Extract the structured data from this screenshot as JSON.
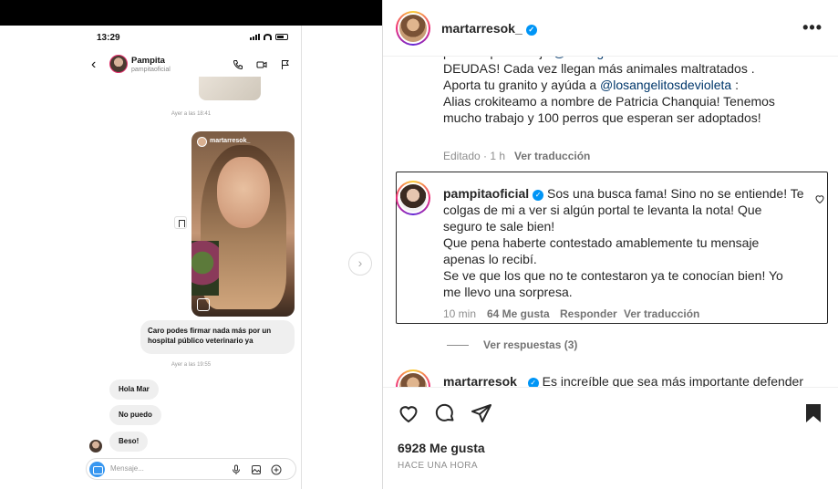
{
  "phone": {
    "time": "13:29",
    "chat_name": "Pampita",
    "chat_user": "pampitaoficial",
    "ts1": "Ayer a las 18:41",
    "story_user": "martarresok_",
    "bubble1": "Caro podes firmar nada más por un hospital público veterinario ya",
    "ts2": "Ayer a las 19:55",
    "msg1": "Hola Mar",
    "msg2": "No puedo",
    "msg3": "Beso!",
    "composer_placeholder": "Mensaje..."
  },
  "post": {
    "author": "martarresok_",
    "caption_l1_pre": "para el que trabajo ",
    "caption_l1_link": "@losangelitosdevioleta",
    "caption_l1_post": " NO DA MÁS DE",
    "caption_l2": "DEUDAS! Cada vez llegan más animales maltratados .",
    "caption_l3_pre": "Aporta tu granito y ayúda a ",
    "caption_l3_link": "@losangelitosdevioleta",
    "caption_l3_post": " :",
    "caption_l4": "Alias crokiteamo a nombre de Patricia Chanquia! Tenemos",
    "caption_l5": "mucho trabajo y 100 perros que esperan ser adoptados!",
    "edited": "Editado · 1 h",
    "translate": "Ver traducción"
  },
  "comment": {
    "author": "pampitaoficial",
    "l1": "Sos una busca fama! Sino no se entiende! Te",
    "l2": "colgas de mi a ver si algún portal te levanta la nota! Que",
    "l3": "seguro te sale bien!",
    "l4": "Que pena haberte contestado amablemente tu mensaje",
    "l5": "apenas lo recibí.",
    "l6": "Se ve que los que no te contestaron ya te conocían bien! Yo",
    "l7": "me llevo una sorpresa.",
    "time": "10 min",
    "likes": "64 Me gusta",
    "reply": "Responder",
    "translate": "Ver traducción"
  },
  "replies": {
    "label": "Ver respuestas (3)"
  },
  "next_comment": {
    "author": "martarresok_",
    "text": "Es increíble que sea más importante defender"
  },
  "footer": {
    "likes": "6928 Me gusta",
    "when": "HACE UNA HORA"
  }
}
